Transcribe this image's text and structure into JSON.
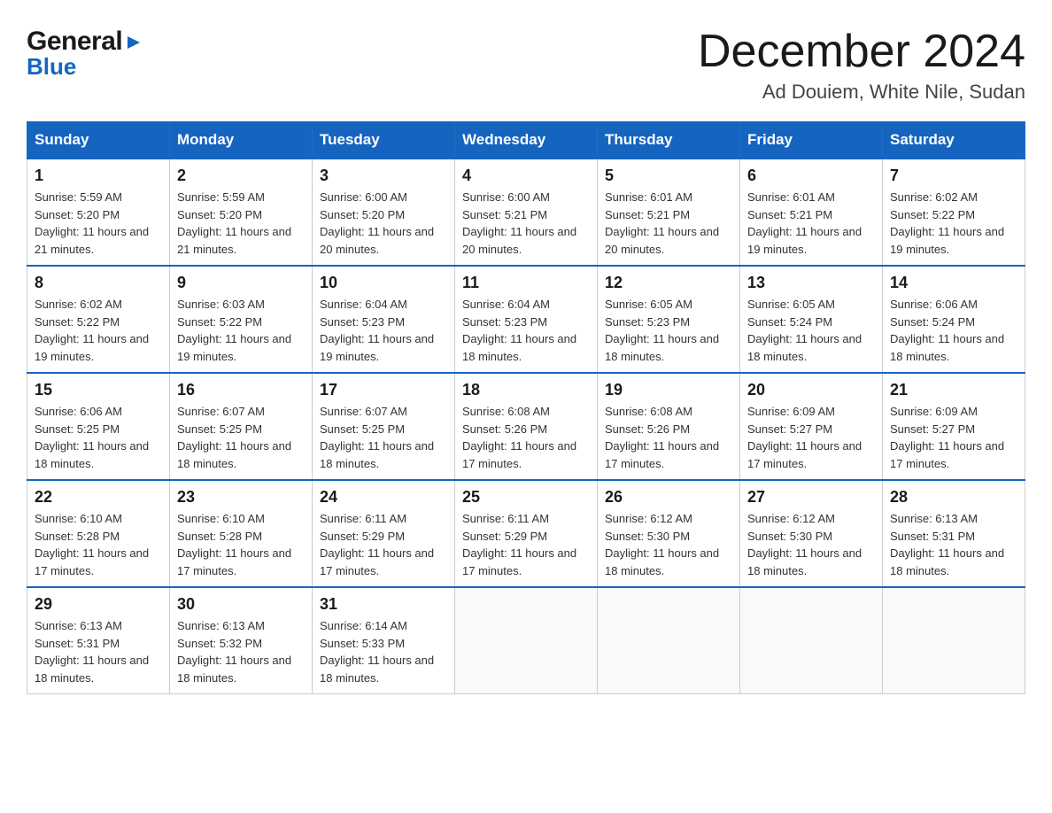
{
  "header": {
    "logo_line1": "General",
    "logo_line2": "Blue",
    "month_title": "December 2024",
    "location": "Ad Douiem, White Nile, Sudan"
  },
  "weekdays": [
    "Sunday",
    "Monday",
    "Tuesday",
    "Wednesday",
    "Thursday",
    "Friday",
    "Saturday"
  ],
  "days": [
    {
      "date": "1",
      "sunrise": "Sunrise: 5:59 AM",
      "sunset": "Sunset: 5:20 PM",
      "daylight": "Daylight: 11 hours and 21 minutes."
    },
    {
      "date": "2",
      "sunrise": "Sunrise: 5:59 AM",
      "sunset": "Sunset: 5:20 PM",
      "daylight": "Daylight: 11 hours and 21 minutes."
    },
    {
      "date": "3",
      "sunrise": "Sunrise: 6:00 AM",
      "sunset": "Sunset: 5:20 PM",
      "daylight": "Daylight: 11 hours and 20 minutes."
    },
    {
      "date": "4",
      "sunrise": "Sunrise: 6:00 AM",
      "sunset": "Sunset: 5:21 PM",
      "daylight": "Daylight: 11 hours and 20 minutes."
    },
    {
      "date": "5",
      "sunrise": "Sunrise: 6:01 AM",
      "sunset": "Sunset: 5:21 PM",
      "daylight": "Daylight: 11 hours and 20 minutes."
    },
    {
      "date": "6",
      "sunrise": "Sunrise: 6:01 AM",
      "sunset": "Sunset: 5:21 PM",
      "daylight": "Daylight: 11 hours and 19 minutes."
    },
    {
      "date": "7",
      "sunrise": "Sunrise: 6:02 AM",
      "sunset": "Sunset: 5:22 PM",
      "daylight": "Daylight: 11 hours and 19 minutes."
    },
    {
      "date": "8",
      "sunrise": "Sunrise: 6:02 AM",
      "sunset": "Sunset: 5:22 PM",
      "daylight": "Daylight: 11 hours and 19 minutes."
    },
    {
      "date": "9",
      "sunrise": "Sunrise: 6:03 AM",
      "sunset": "Sunset: 5:22 PM",
      "daylight": "Daylight: 11 hours and 19 minutes."
    },
    {
      "date": "10",
      "sunrise": "Sunrise: 6:04 AM",
      "sunset": "Sunset: 5:23 PM",
      "daylight": "Daylight: 11 hours and 19 minutes."
    },
    {
      "date": "11",
      "sunrise": "Sunrise: 6:04 AM",
      "sunset": "Sunset: 5:23 PM",
      "daylight": "Daylight: 11 hours and 18 minutes."
    },
    {
      "date": "12",
      "sunrise": "Sunrise: 6:05 AM",
      "sunset": "Sunset: 5:23 PM",
      "daylight": "Daylight: 11 hours and 18 minutes."
    },
    {
      "date": "13",
      "sunrise": "Sunrise: 6:05 AM",
      "sunset": "Sunset: 5:24 PM",
      "daylight": "Daylight: 11 hours and 18 minutes."
    },
    {
      "date": "14",
      "sunrise": "Sunrise: 6:06 AM",
      "sunset": "Sunset: 5:24 PM",
      "daylight": "Daylight: 11 hours and 18 minutes."
    },
    {
      "date": "15",
      "sunrise": "Sunrise: 6:06 AM",
      "sunset": "Sunset: 5:25 PM",
      "daylight": "Daylight: 11 hours and 18 minutes."
    },
    {
      "date": "16",
      "sunrise": "Sunrise: 6:07 AM",
      "sunset": "Sunset: 5:25 PM",
      "daylight": "Daylight: 11 hours and 18 minutes."
    },
    {
      "date": "17",
      "sunrise": "Sunrise: 6:07 AM",
      "sunset": "Sunset: 5:25 PM",
      "daylight": "Daylight: 11 hours and 18 minutes."
    },
    {
      "date": "18",
      "sunrise": "Sunrise: 6:08 AM",
      "sunset": "Sunset: 5:26 PM",
      "daylight": "Daylight: 11 hours and 17 minutes."
    },
    {
      "date": "19",
      "sunrise": "Sunrise: 6:08 AM",
      "sunset": "Sunset: 5:26 PM",
      "daylight": "Daylight: 11 hours and 17 minutes."
    },
    {
      "date": "20",
      "sunrise": "Sunrise: 6:09 AM",
      "sunset": "Sunset: 5:27 PM",
      "daylight": "Daylight: 11 hours and 17 minutes."
    },
    {
      "date": "21",
      "sunrise": "Sunrise: 6:09 AM",
      "sunset": "Sunset: 5:27 PM",
      "daylight": "Daylight: 11 hours and 17 minutes."
    },
    {
      "date": "22",
      "sunrise": "Sunrise: 6:10 AM",
      "sunset": "Sunset: 5:28 PM",
      "daylight": "Daylight: 11 hours and 17 minutes."
    },
    {
      "date": "23",
      "sunrise": "Sunrise: 6:10 AM",
      "sunset": "Sunset: 5:28 PM",
      "daylight": "Daylight: 11 hours and 17 minutes."
    },
    {
      "date": "24",
      "sunrise": "Sunrise: 6:11 AM",
      "sunset": "Sunset: 5:29 PM",
      "daylight": "Daylight: 11 hours and 17 minutes."
    },
    {
      "date": "25",
      "sunrise": "Sunrise: 6:11 AM",
      "sunset": "Sunset: 5:29 PM",
      "daylight": "Daylight: 11 hours and 17 minutes."
    },
    {
      "date": "26",
      "sunrise": "Sunrise: 6:12 AM",
      "sunset": "Sunset: 5:30 PM",
      "daylight": "Daylight: 11 hours and 18 minutes."
    },
    {
      "date": "27",
      "sunrise": "Sunrise: 6:12 AM",
      "sunset": "Sunset: 5:30 PM",
      "daylight": "Daylight: 11 hours and 18 minutes."
    },
    {
      "date": "28",
      "sunrise": "Sunrise: 6:13 AM",
      "sunset": "Sunset: 5:31 PM",
      "daylight": "Daylight: 11 hours and 18 minutes."
    },
    {
      "date": "29",
      "sunrise": "Sunrise: 6:13 AM",
      "sunset": "Sunset: 5:31 PM",
      "daylight": "Daylight: 11 hours and 18 minutes."
    },
    {
      "date": "30",
      "sunrise": "Sunrise: 6:13 AM",
      "sunset": "Sunset: 5:32 PM",
      "daylight": "Daylight: 11 hours and 18 minutes."
    },
    {
      "date": "31",
      "sunrise": "Sunrise: 6:14 AM",
      "sunset": "Sunset: 5:33 PM",
      "daylight": "Daylight: 11 hours and 18 minutes."
    }
  ],
  "colors": {
    "header_bg": "#1565C0",
    "header_text": "#ffffff",
    "border": "#1565C0",
    "accent": "#1565C0"
  }
}
